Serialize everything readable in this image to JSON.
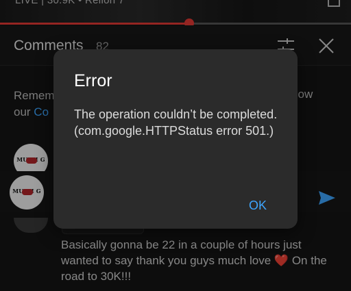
{
  "video": {
    "title_fragment": "LIVE | 30.9K • Relion 7",
    "progress_fraction": 0.54
  },
  "comments_header": {
    "title": "Comments",
    "count": "82",
    "filter_icon": "filter-sliders-icon",
    "close_icon": "close-icon"
  },
  "reminder": {
    "text_start": "Remem",
    "text_line2_start": "our ",
    "link_text": "Co",
    "text_right": "llow"
  },
  "avatars": {
    "label": "MULTI G"
  },
  "comment": {
    "text_before_heart": "Basically gonna be 22 in a couple of hours just wanted to say thank you guys much love",
    "heart": "❤️",
    "text_after_heart": "On the road to 30K!!!"
  },
  "send_icon": "send-icon",
  "dialog": {
    "title": "Error",
    "message": "The operation couldn’t be completed. (com.google.HTTPStatus error 501.)",
    "ok_label": "OK"
  },
  "colors": {
    "accent_red": "#e53935",
    "link_blue": "#3ea6ff",
    "dialog_bg": "#2b2b2b"
  }
}
